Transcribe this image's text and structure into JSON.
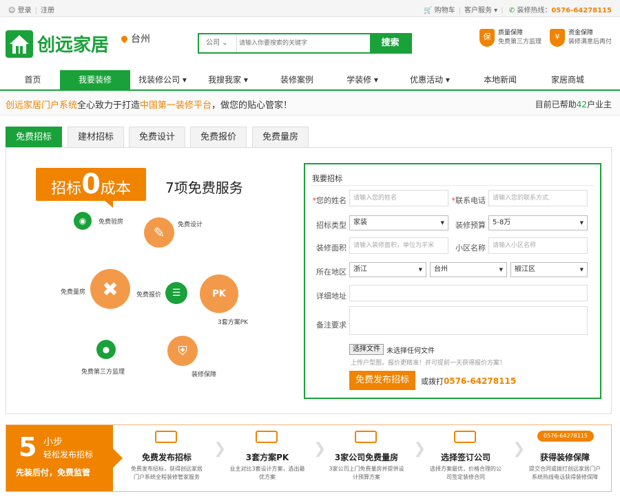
{
  "topbar": {
    "login": "登录",
    "register": "注册",
    "cart": "购物车",
    "service": "客户服务",
    "hotline_label": "装修热线：",
    "hotline": "0576-64278115"
  },
  "brand": {
    "name": "创远家居",
    "city": "台州"
  },
  "search": {
    "scope": "公司",
    "placeholder": "请输入你要搜索的关键字",
    "button": "搜索"
  },
  "guarantees": [
    {
      "icon": "保",
      "title": "质量保障",
      "desc": "免费第三方监理"
    },
    {
      "icon": "¥",
      "title": "资金保障",
      "desc": "装修满意后再付"
    }
  ],
  "nav": [
    {
      "label": "首页"
    },
    {
      "label": "我要装修"
    },
    {
      "label": "找装修公司 ▾"
    },
    {
      "label": "我搜我家 ▾"
    },
    {
      "label": "装修案例"
    },
    {
      "label": "学装修 ▾"
    },
    {
      "label": "优惠活动 ▾"
    },
    {
      "label": "本地新闻"
    },
    {
      "label": "家居商城"
    }
  ],
  "slogan": {
    "part1": "创远家居门户系统",
    "part2": "全心致力于打造",
    "part3": "中国第一装修平台",
    "part4": "，做您的贴心管家！",
    "right_pre": "目前已帮助",
    "right_num": "42",
    "right_post": "户业主"
  },
  "tabs": [
    {
      "label": "免费招标"
    },
    {
      "label": "建材招标"
    },
    {
      "label": "免费设计"
    },
    {
      "label": "免费报价"
    },
    {
      "label": "免费量房"
    }
  ],
  "promo": {
    "badge_pre": "招标",
    "badge_zero": "0",
    "badge_post": "成本",
    "title": "7项免费服务",
    "services": [
      "免费验房",
      "免费设计",
      "免费量房",
      "免费报价",
      "3套方案PK",
      "免费第三方监理",
      "装修保障"
    ]
  },
  "form": {
    "title": "我要招标",
    "name_label": "您的姓名",
    "name_ph": "请输入您的姓名",
    "phone_label": "联系电话",
    "phone_ph": "请输入您的联系方式",
    "type_label": "招标类型",
    "type_value": "家装",
    "budget_label": "装修预算",
    "budget_value": "5-8万",
    "area_label": "装修面积",
    "area_ph": "请输入装修面积，单位为平米",
    "community_label": "小区名称",
    "community_ph": "请输入小区名称",
    "region_label": "所在地区",
    "province": "浙江",
    "cityv": "台州",
    "district": "椒江区",
    "address_label": "详细地址",
    "remark_label": "备注要求",
    "file_button": "选择文件",
    "file_status": "未选择任何文件",
    "upload_hint": "上传户型图，报价更精准！并可提前一天获得报价方案！",
    "submit": "免费发布招标",
    "or_call": "或拨打",
    "phone": "0576-64278115"
  },
  "steps": {
    "number": "5",
    "line1": "小步",
    "line2": "轻松发布招标",
    "line3": "先装后付，免费监管",
    "items": [
      {
        "title": "免费发布招标",
        "desc": "免费发布招标，获得创远家居门户系统全程装修管家服务"
      },
      {
        "title": "3套方案PK",
        "desc": "业主对比3套设计方案，选出最优方案"
      },
      {
        "title": "3家公司免费量房",
        "desc": "3家公司上门免费量房并提供设计预算方案"
      },
      {
        "title": "选择签订公司",
        "desc": "选择方案最优，价格合理的公司签定装修合同"
      },
      {
        "title": "获得装修保障",
        "desc": "提交合同或拨打创远家居门户系统热线电话获得装修保障"
      }
    ],
    "hotline_tag": "0576-64278115"
  },
  "colors": {
    "green": "#1aa13a",
    "orange": "#f08300"
  }
}
